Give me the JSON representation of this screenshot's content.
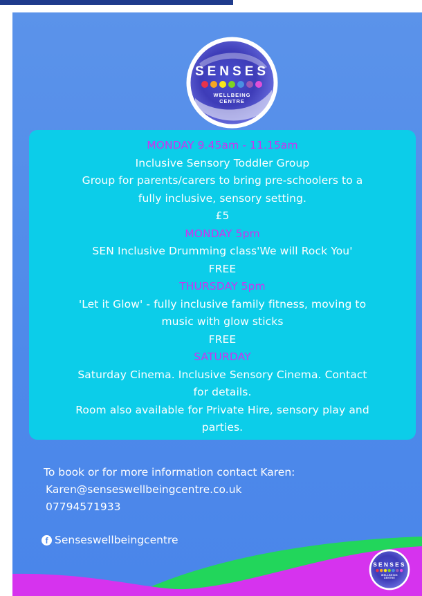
{
  "logo": {
    "word": "SENSES",
    "tagline_line1": "WELLBEING",
    "tagline_line2": "CENTRE",
    "dot_colors": [
      "#e8334a",
      "#f5a623",
      "#f8e71c",
      "#7ed321",
      "#4a90e2",
      "#9b59b6",
      "#e04fd8"
    ]
  },
  "schedule": [
    {
      "text": "MONDAY  9.45am - 11.15am",
      "heading": true
    },
    {
      "text": "Inclusive Sensory Toddler Group",
      "heading": false
    },
    {
      "text": "Group for parents/carers to bring pre-schoolers to a",
      "heading": false
    },
    {
      "text": "fully inclusive, sensory setting.",
      "heading": false
    },
    {
      "text": "£5",
      "heading": false
    },
    {
      "text": "MONDAY 5pm",
      "heading": true
    },
    {
      "text": "SEN Inclusive Drumming class'We will Rock You'",
      "heading": false
    },
    {
      "text": "FREE",
      "heading": false
    },
    {
      "text": "THURSDAY 5pm",
      "heading": true
    },
    {
      "text": "'Let it Glow' - fully inclusive family fitness, moving to",
      "heading": false
    },
    {
      "text": "music with glow sticks",
      "heading": false
    },
    {
      "text": "FREE",
      "heading": false
    },
    {
      "text": "SATURDAY",
      "heading": true
    },
    {
      "text": "Saturday Cinema.  Inclusive Sensory Cinema. Contact",
      "heading": false
    },
    {
      "text": "for details.",
      "heading": false
    },
    {
      "text": "Room also available for Private Hire, sensory play and",
      "heading": false
    },
    {
      "text": "parties.",
      "heading": false
    }
  ],
  "contact": {
    "intro": "To book or for more information contact Karen:",
    "email": "Karen@senseswellbeingcentre.co.uk",
    "phone": "07794571933"
  },
  "social": {
    "icon": "facebook-icon",
    "handle": "Senseswellbeingcentre"
  },
  "colors": {
    "background": "#4e89ea",
    "panel": "#0ccde9",
    "heading_text": "#cc33ee",
    "body_text": "#ffffff",
    "wave_green": "#22d65b",
    "wave_magenta": "#d633ee"
  }
}
